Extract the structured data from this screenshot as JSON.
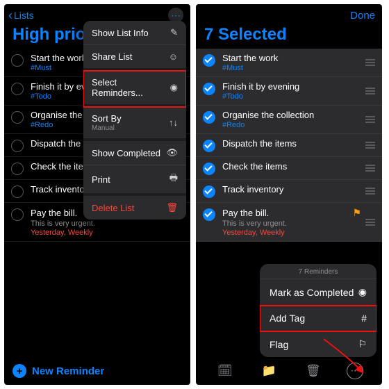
{
  "left": {
    "back_label": "Lists",
    "title": "High prio",
    "new_reminder": "New Reminder",
    "menu": {
      "info": "Show List Info",
      "share": "Share List",
      "select": "Select Reminders...",
      "sort": "Sort By",
      "sort_sub": "Manual",
      "completed": "Show Completed",
      "print": "Print",
      "delete": "Delete List"
    },
    "items": [
      {
        "title": "Start the work",
        "tag": "#Must"
      },
      {
        "title": "Finish it by ev",
        "tag": "#Todo"
      },
      {
        "title": "Organise the",
        "tag": "#Redo"
      },
      {
        "title": "Dispatch the i"
      },
      {
        "title": "Check the iter"
      },
      {
        "title": "Track inventory"
      },
      {
        "title": "Pay the bill.",
        "note": "This is very urgent.",
        "due": "Yesterday, Weekly",
        "flag": true
      }
    ]
  },
  "right": {
    "done": "Done",
    "title": "7 Selected",
    "items": [
      {
        "title": "Start the work",
        "tag": "#Must"
      },
      {
        "title": "Finish it by evening",
        "tag": "#Todo"
      },
      {
        "title": "Organise the collection",
        "tag": "#Redo"
      },
      {
        "title": "Dispatch the items"
      },
      {
        "title": "Check the items"
      },
      {
        "title": "Track inventory"
      },
      {
        "title": "Pay the bill.",
        "note": "This is very urgent.",
        "due": "Yesterday, Weekly",
        "flag": true
      }
    ],
    "sheet": {
      "header": "7 Reminders",
      "mark": "Mark as Completed",
      "addtag": "Add Tag",
      "flag": "Flag"
    }
  }
}
